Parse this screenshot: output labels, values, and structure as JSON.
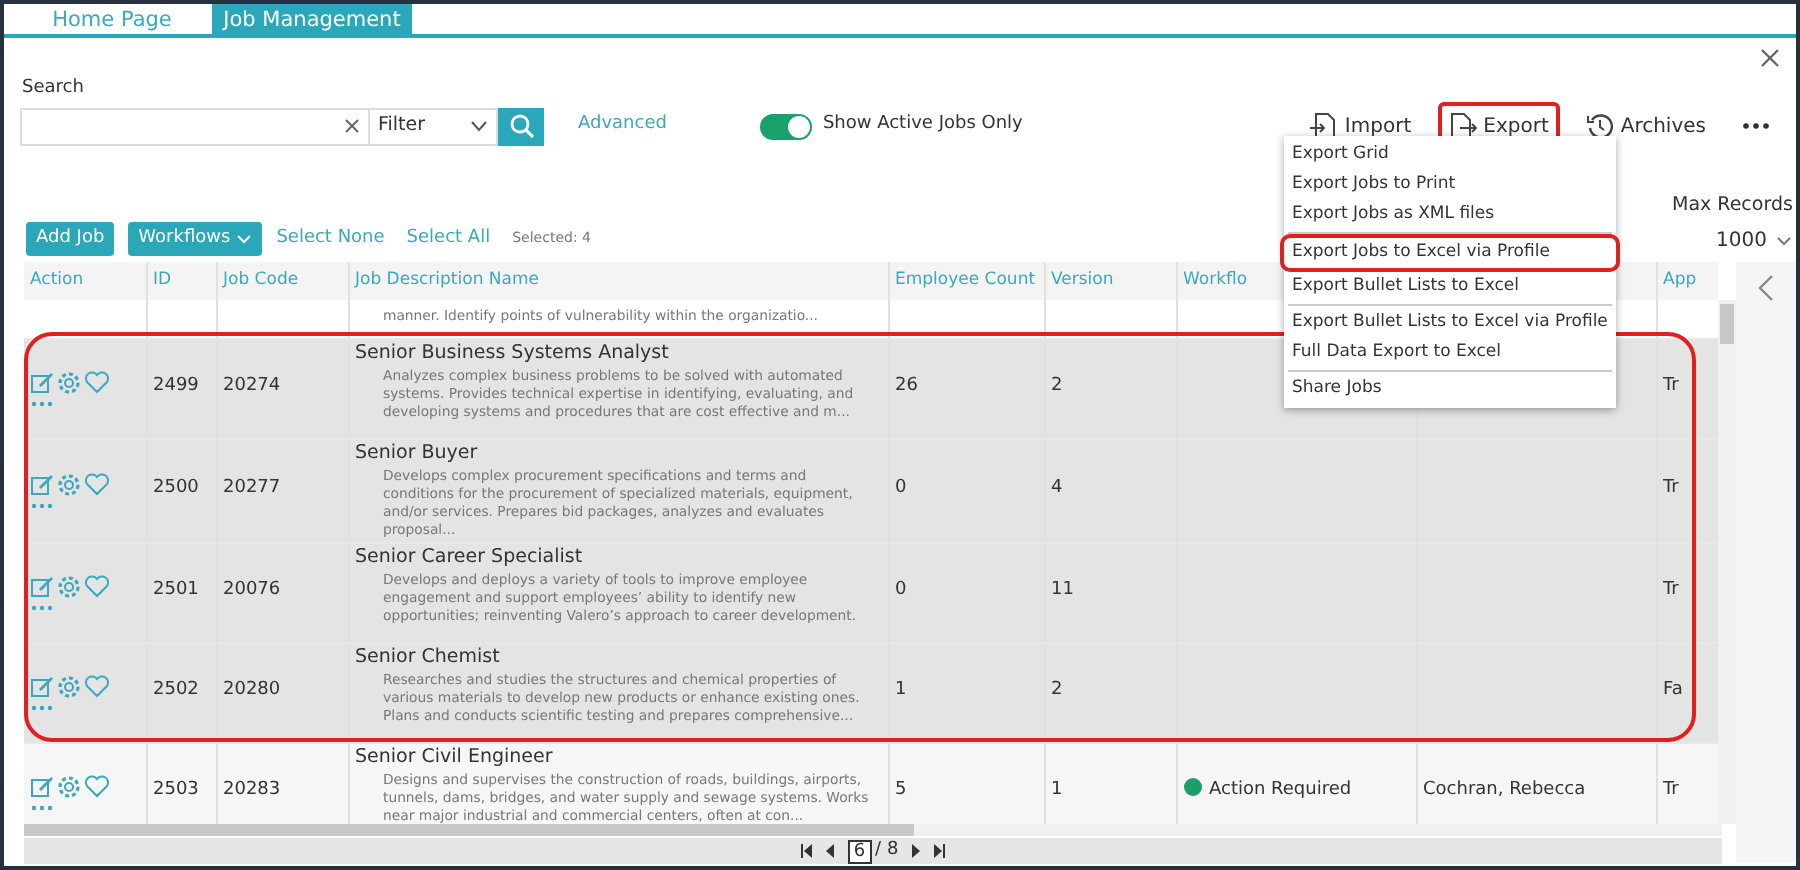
{
  "tabs": [
    {
      "label": "Home Page",
      "selected": false
    },
    {
      "label": "Job Management",
      "selected": true
    }
  ],
  "search": {
    "label": "Search",
    "filter": "Filter",
    "advanced": "Advanced",
    "toggle": {
      "label": "Show Active Jobs Only",
      "on": true
    }
  },
  "toolbar_right": [
    {
      "kind": "import",
      "label": "Import",
      "outlined": false
    },
    {
      "kind": "export",
      "label": "Export",
      "outlined": true
    },
    {
      "kind": "archives",
      "label": "Archives",
      "outlined": false
    },
    {
      "kind": "more",
      "outlined": false
    }
  ],
  "export_menu": [
    {
      "kind": "item",
      "label": "Export Grid",
      "outlined": false
    },
    {
      "kind": "item",
      "label": "Export Jobs to Print",
      "outlined": false
    },
    {
      "kind": "item",
      "label": "Export Jobs as XML files",
      "outlined": false
    },
    {
      "kind": "divider"
    },
    {
      "kind": "item",
      "label": "Export Jobs to Excel via Profile",
      "outlined": true
    },
    {
      "kind": "item",
      "label": "Export Bullet Lists to Excel",
      "outlined": false
    },
    {
      "kind": "divider"
    },
    {
      "kind": "item",
      "label": "Export Bullet Lists to Excel via Profile",
      "outlined": false
    },
    {
      "kind": "item",
      "label": "Full Data Export to Excel",
      "outlined": false
    },
    {
      "kind": "divider"
    },
    {
      "kind": "item",
      "label": "Share Jobs",
      "outlined": false
    }
  ],
  "actions": {
    "add": "Add Job",
    "workflows": "Workflows",
    "select_none": "Select None",
    "select_all": "Select All",
    "selected_count": "Selected: 4"
  },
  "max_records": {
    "label": "Max Records",
    "value": "1000"
  },
  "table": {
    "columns": [
      "Action",
      "ID",
      "Job Code",
      "Job Description Name",
      "Employee Count",
      "Version",
      "Workflo",
      "",
      "App"
    ],
    "rows": [
      {
        "kind": "partial",
        "selected": false,
        "outlined": false,
        "description": "manner. Identify points of vulnerability within the organizatio..."
      },
      {
        "kind": "full",
        "selected": true,
        "outlined": true,
        "id": "2499",
        "code": "20274",
        "title": "Senior Business Systems Analyst",
        "description": "Analyzes complex business problems to be solved with automated systems.  Provides technical expertise in identifying, evaluating, and developing systems and procedures that are cost effective and m...",
        "employee_count": "26",
        "version": "2",
        "column_9": "Tr"
      },
      {
        "kind": "full",
        "selected": true,
        "outlined": true,
        "id": "2500",
        "code": "20277",
        "title": "Senior Buyer",
        "description": "Develops complex procurement specifications and terms and conditions for the procurement of specialized materials, equipment, and/or services. Prepares bid packages, analyzes and evaluates proposal...",
        "employee_count": "0",
        "version": "4",
        "column_9": "Tr"
      },
      {
        "kind": "full",
        "selected": true,
        "outlined": true,
        "id": "2501",
        "code": "20076",
        "title": "Senior Career Specialist",
        "description": "Develops and deploys a variety of tools to improve employee engagement and support employees’ ability to identify new opportunities; reinventing Valero’s approach to career development.",
        "employee_count": "0",
        "version": "11",
        "column_9": "Tr"
      },
      {
        "kind": "full",
        "selected": true,
        "outlined": true,
        "id": "2502",
        "code": "20280",
        "title": "Senior Chemist",
        "description": "Researches and studies the structures and chemical properties of various materials to develop new products or enhance existing ones. Plans and conducts scientific testing and prepares comprehensive...",
        "employee_count": "1",
        "version": "2",
        "column_9": "Fa"
      },
      {
        "kind": "full",
        "selected": false,
        "outlined": false,
        "id": "2503",
        "code": "20283",
        "title": "Senior Civil Engineer",
        "description": "Designs and supervises the construction of roads, buildings, airports, tunnels, dams, bridges, and water supply and sewage systems.  Works near major industrial and commercial centers, often at con...",
        "employee_count": "5",
        "version": "1",
        "workflow": {
          "text": "Action Required",
          "color": "#1a9e6a"
        },
        "assignee": "Cochran, Rebecca",
        "column_9": "Tr"
      }
    ]
  },
  "pagination": {
    "page": "6",
    "total": "/ 8"
  }
}
